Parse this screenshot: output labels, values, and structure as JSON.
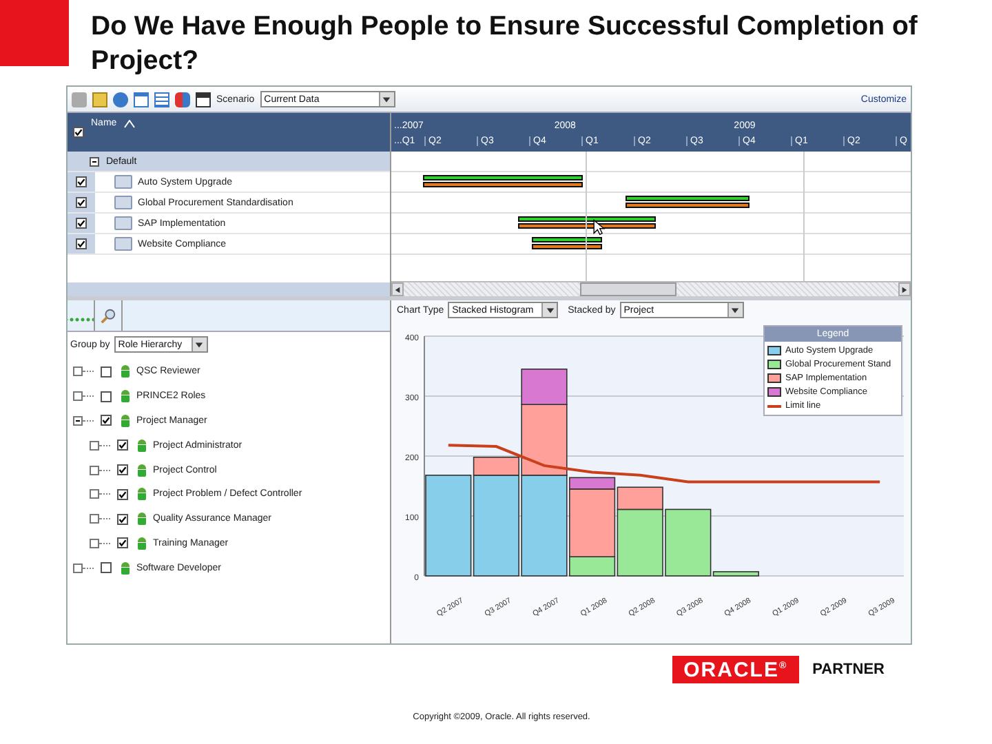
{
  "slide_title": "Do We Have Enough People to Ensure Successful Completion of Project?",
  "toolbar": {
    "scenario_label": "Scenario",
    "scenario_value": "Current Data",
    "customize": "Customize"
  },
  "project_grid": {
    "name_header": "Name",
    "header_checked": true,
    "group": {
      "label": "Default",
      "expanded": true
    },
    "rows": [
      {
        "name": "Auto System Upgrade",
        "checked": true
      },
      {
        "name": "Global Procurement Standardisation",
        "checked": true
      },
      {
        "name": "SAP Implementation",
        "checked": true
      },
      {
        "name": "Website Compliance",
        "checked": true
      }
    ]
  },
  "timeline": {
    "years": [
      "...2007",
      "2008",
      "2009"
    ],
    "quarters": [
      "...Q1",
      "Q2",
      "Q3",
      "Q4",
      "Q1",
      "Q2",
      "Q3",
      "Q4",
      "Q1",
      "Q2",
      "Q"
    ]
  },
  "role_panel": {
    "group_by_label": "Group by",
    "group_by_value": "Role Hierarchy",
    "roles": [
      {
        "name": "QSC Reviewer",
        "checked": false,
        "expanded": false
      },
      {
        "name": "PRINCE2 Roles",
        "checked": false,
        "expanded": false
      },
      {
        "name": "Project Manager",
        "checked": true,
        "expanded": true,
        "children": [
          {
            "name": "Project Administrator",
            "checked": true,
            "expanded": false
          },
          {
            "name": "Project Control",
            "checked": true,
            "expanded": false
          },
          {
            "name": "Project Problem / Defect Controller",
            "checked": true,
            "expanded": false
          },
          {
            "name": "Quality Assurance Manager",
            "checked": true,
            "expanded": false
          },
          {
            "name": "Training Manager",
            "checked": true,
            "expanded": false
          }
        ]
      },
      {
        "name": "Software Developer",
        "checked": false,
        "expanded": false
      }
    ]
  },
  "chart_controls": {
    "chart_type_label": "Chart Type",
    "chart_type_value": "Stacked Histogram",
    "stacked_by_label": "Stacked by",
    "stacked_by_value": "Project"
  },
  "chart": {
    "legend_title": "Legend",
    "chart_data": {
      "type": "bar",
      "stacked": true,
      "grid": true,
      "legend": "upper right",
      "categories": [
        "Q2 2007",
        "Q3 2007",
        "Q4 2007",
        "Q1 2008",
        "Q2 2008",
        "Q3 2008",
        "Q4 2008",
        "Q1 2009",
        "Q2 2009",
        "Q3 2009"
      ],
      "ylim": [
        0,
        400
      ],
      "yticks": [
        0,
        100,
        200,
        300,
        400
      ],
      "series": [
        {
          "name": "Auto System Upgrade",
          "color": "#87ceeb",
          "values": [
            168,
            168,
            168,
            0,
            0,
            0,
            0,
            0,
            0,
            0
          ]
        },
        {
          "name": "Global Procurement Stand",
          "color": "#98e898",
          "values": [
            0,
            0,
            0,
            32,
            111,
            111,
            7,
            null,
            null,
            null
          ]
        },
        {
          "name": "SAP Implementation",
          "color": "#ffa09a",
          "values": [
            0,
            30,
            118,
            113,
            37,
            0,
            0,
            0,
            0,
            0
          ]
        },
        {
          "name": "Website Compliance",
          "color": "#d878d0",
          "values": [
            0,
            0,
            59,
            19,
            0,
            0,
            0,
            0,
            0,
            0
          ]
        },
        {
          "name": "Limit line",
          "type": "line",
          "color": "#c8401c",
          "values": [
            218,
            216,
            184,
            173,
            168,
            157,
            157,
            157,
            157,
            157
          ]
        }
      ]
    }
  },
  "footer": {
    "logo": "ORACLE$^{®}$",
    "partner": "PARTNER",
    "copyright": "Copyright ©2009, Oracle. All rights reserved."
  }
}
